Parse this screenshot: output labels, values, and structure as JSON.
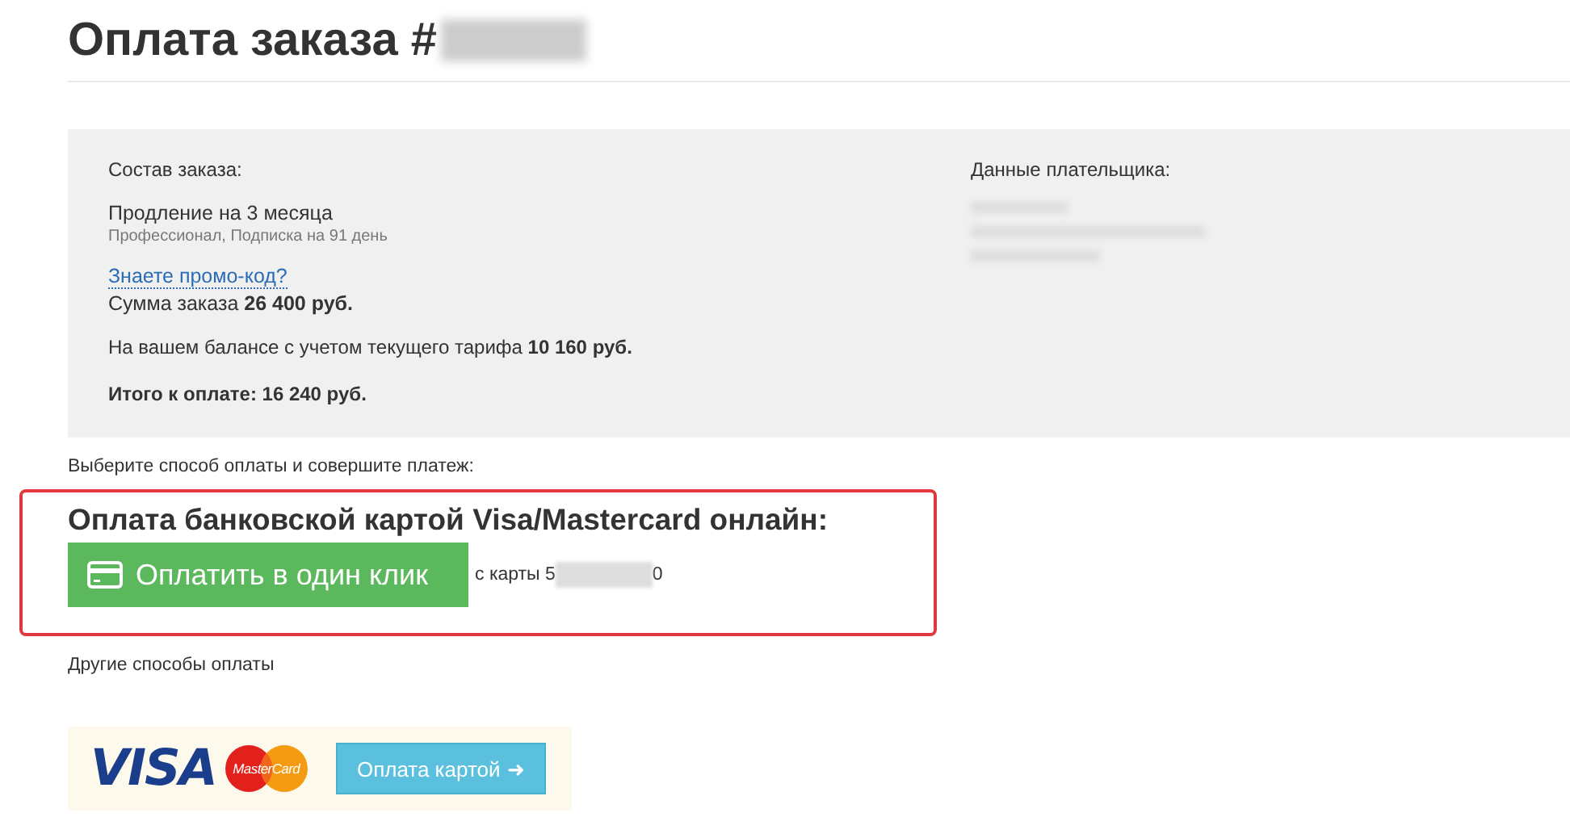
{
  "page_title": "Оплата заказа #",
  "order": {
    "heading": "Состав заказа:",
    "item": "Продление на 3 месяца",
    "item_details": "Профессионал, Подписка на 91 день",
    "promo_link": "Знаете промо-код?",
    "sum": "Сумма заказа **26 400 руб.**",
    "balance": "На вашем балансе с учетом текущего тарифа **10 160 руб.**",
    "total": "Итого к оплате: 16 240 руб."
  },
  "payer": {
    "heading": "Данные плательщика:"
  },
  "choose_hint": "Выберите способ оплаты и совершите платеж:",
  "card_payment": {
    "heading": "Оплата банковской картой Visa/Mastercard онлайн:",
    "button": "Оплатить в один клик",
    "card_prefix": "с карты 5",
    "card_suffix": "0"
  },
  "other_methods": "Другие способы оплаты",
  "alt_payment": {
    "logos": [
      "VISA",
      "MasterCard"
    ],
    "button": "Оплата картой",
    "button_arrow": "➜"
  }
}
